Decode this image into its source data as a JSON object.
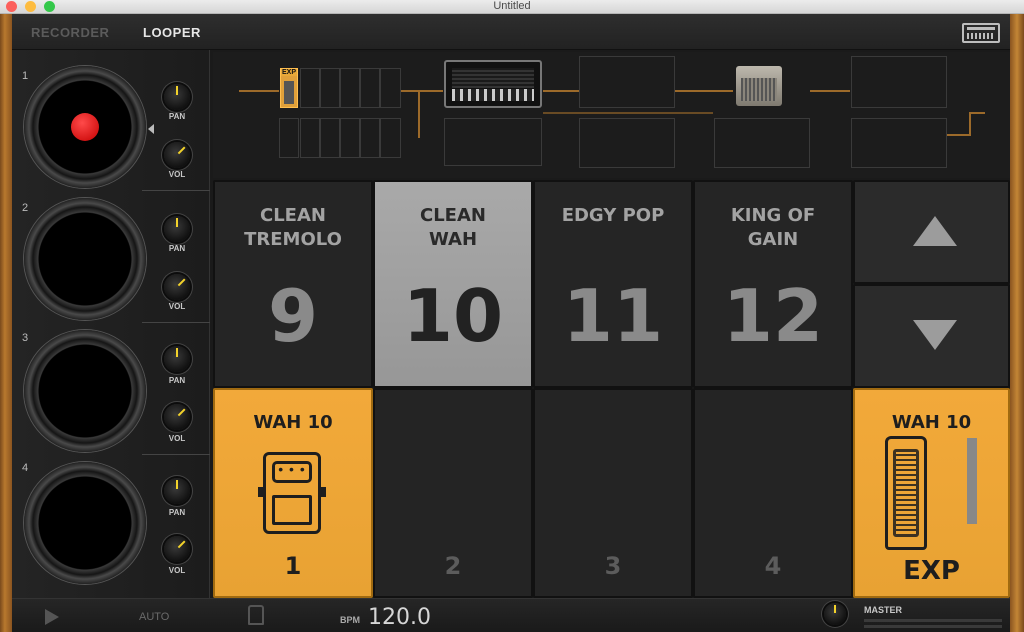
{
  "window": {
    "title": "Untitled"
  },
  "colors": {
    "accent": "#e8a233",
    "active_preset": "#a3a3a3",
    "rec_red": "#d61010",
    "knob_indicator": "#f2d22b",
    "mac_close": "#fc605c",
    "mac_min": "#fdbc40",
    "mac_max": "#34c84a"
  },
  "topbar": {
    "tabs": [
      {
        "label": "RECORDER",
        "active": false
      },
      {
        "label": "LOOPER",
        "active": true
      }
    ],
    "device_icon": "device-panel-icon"
  },
  "looper": {
    "tracks": [
      {
        "number": "1",
        "recording": true,
        "pan_label": "PAN",
        "vol_label": "VOL"
      },
      {
        "number": "2",
        "recording": false,
        "pan_label": "PAN",
        "vol_label": "VOL"
      },
      {
        "number": "3",
        "recording": false,
        "pan_label": "PAN",
        "vol_label": "VOL"
      },
      {
        "number": "4",
        "recording": false,
        "pan_label": "PAN",
        "vol_label": "VOL"
      }
    ]
  },
  "signal_chain": {
    "exp_badge": "EXP"
  },
  "presets": [
    {
      "name_line1": "CLEAN",
      "name_line2": "TREMOLO",
      "number": "9",
      "active": false
    },
    {
      "name_line1": "CLEAN",
      "name_line2": "WAH",
      "number": "10",
      "active": true
    },
    {
      "name_line1": "EDGY POP",
      "name_line2": "",
      "number": "11",
      "active": false
    },
    {
      "name_line1": "KING OF",
      "name_line2": "GAIN",
      "number": "12",
      "active": false
    }
  ],
  "nav": {
    "up_icon": "arrow-up-icon",
    "down_icon": "arrow-down-icon"
  },
  "footswitches": [
    {
      "label": "WAH 10",
      "index": "1",
      "on": true,
      "icon": "stompbox-icon"
    },
    {
      "label": "",
      "index": "2",
      "on": false
    },
    {
      "label": "",
      "index": "3",
      "on": false
    },
    {
      "label": "",
      "index": "4",
      "on": false
    }
  ],
  "expression": {
    "label": "WAH 10",
    "mode": "EXP",
    "icon": "wah-pedal-icon"
  },
  "bottombar": {
    "auto_label": "AUTO",
    "bpm_label": "BPM",
    "bpm_value": "120.0",
    "master_label": "MASTER"
  }
}
